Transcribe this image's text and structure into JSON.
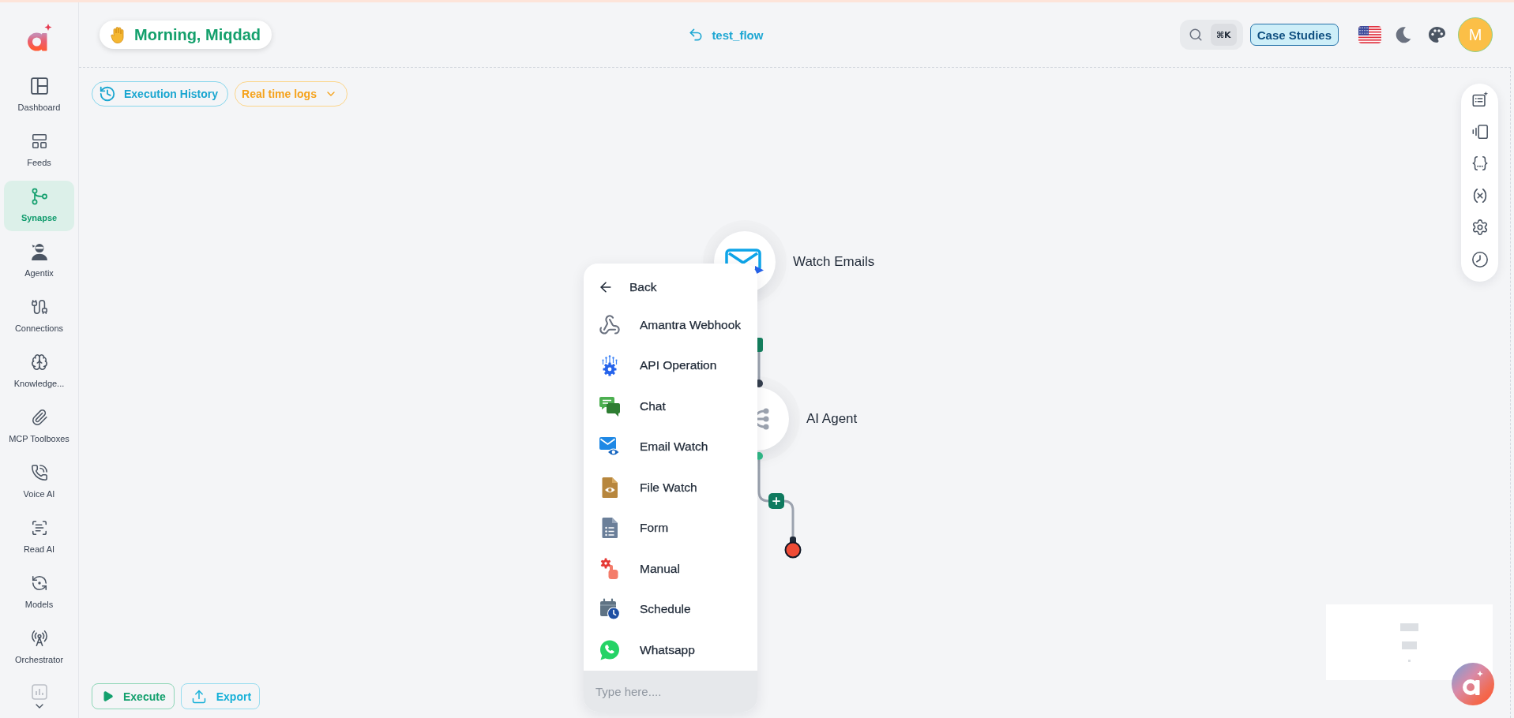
{
  "sidebar": {
    "items": [
      {
        "label": "Dashboard",
        "selected": false
      },
      {
        "label": "Feeds",
        "selected": false
      },
      {
        "label": "Synapse",
        "selected": true
      },
      {
        "label": "Agentix",
        "selected": false
      },
      {
        "label": "Connections",
        "selected": false
      },
      {
        "label": "Knowledge...",
        "selected": false
      },
      {
        "label": "MCP Toolboxes",
        "selected": false
      },
      {
        "label": "Voice AI",
        "selected": false
      },
      {
        "label": "Read AI",
        "selected": false
      },
      {
        "label": "Models",
        "selected": false
      },
      {
        "label": "Orchestrator",
        "selected": false
      }
    ]
  },
  "header": {
    "greeting": "Morning, Miqdad",
    "flow_name": "test_flow",
    "search_shortcut": "⌘K",
    "case_studies": "Case Studies",
    "avatar_initial": "M"
  },
  "canvas_toolbar": {
    "execution_history": "Execution History",
    "real_time_logs": "Real time logs"
  },
  "nodes": [
    {
      "kind": "email_trigger",
      "label": "Watch Emails"
    },
    {
      "kind": "ai_agent",
      "label": "AI Agent"
    }
  ],
  "trigger_menu": {
    "back": "Back",
    "items": [
      {
        "label": "Amantra Webhook"
      },
      {
        "label": "API Operation"
      },
      {
        "label": "Chat"
      },
      {
        "label": "Email Watch"
      },
      {
        "label": "File Watch"
      },
      {
        "label": "Form"
      },
      {
        "label": "Manual"
      },
      {
        "label": "Schedule"
      },
      {
        "label": "Whatsapp"
      }
    ],
    "search": {
      "placeholder": "Type here...."
    }
  },
  "actions": [
    {
      "kind": "execute",
      "label": "Execute"
    },
    {
      "kind": "export",
      "label": "Export"
    }
  ]
}
